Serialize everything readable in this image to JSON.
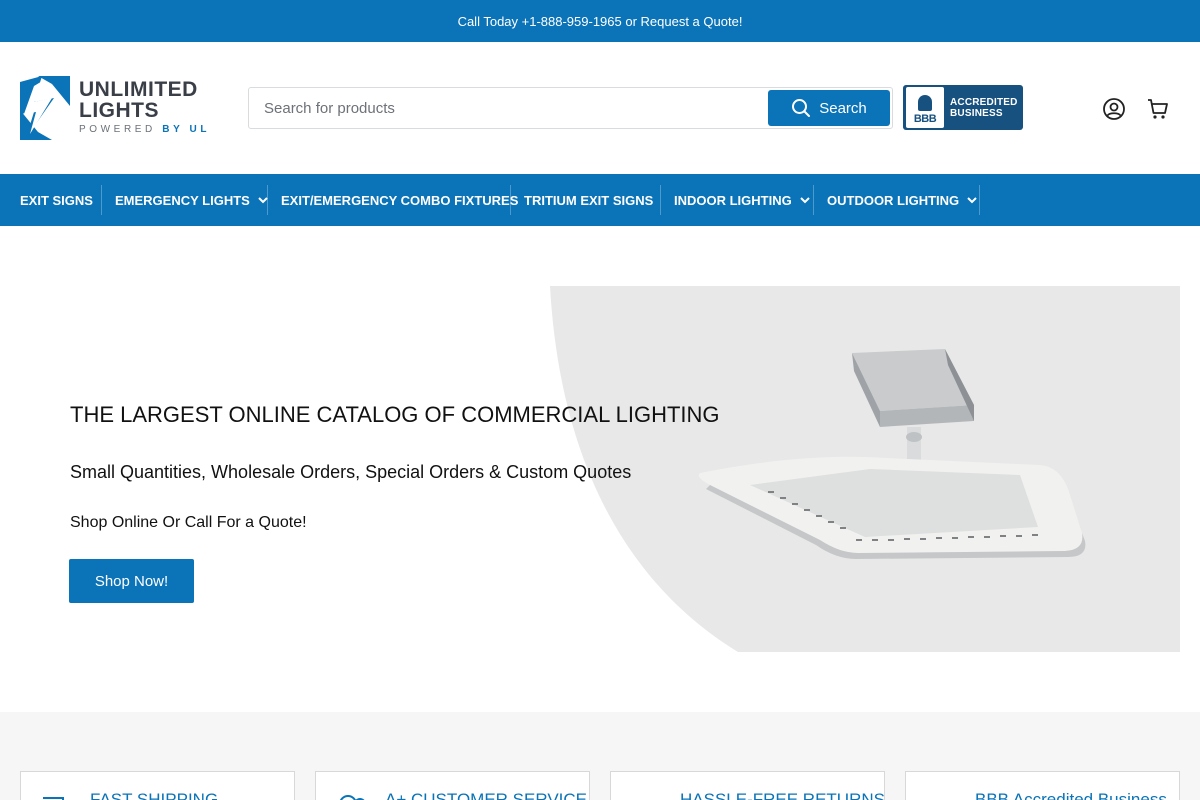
{
  "topbar": {
    "text": "Call Today +1-888-959-1965 or Request a Quote!"
  },
  "logo": {
    "line1": "UNLIMITED",
    "line2": "LIGHTS",
    "sub_prefix": "POWERED",
    "sub_brand": "BY UL"
  },
  "search": {
    "placeholder": "Search for products",
    "value": "",
    "button_label": "Search",
    "icon": "search-icon"
  },
  "bbb_badge": {
    "mark": "BBB",
    "line1": "ACCREDITED",
    "line2": "BUSINESS"
  },
  "header_icons": [
    "account-icon",
    "cart-icon"
  ],
  "nav": {
    "items": [
      {
        "label": "EXIT SIGNS",
        "has_dropdown": false
      },
      {
        "label": "EMERGENCY LIGHTS",
        "has_dropdown": true
      },
      {
        "label": "EXIT/EMERGENCY COMBO FIXTURES",
        "has_dropdown": false
      },
      {
        "label": "TRITIUM EXIT SIGNS",
        "has_dropdown": false
      },
      {
        "label": "INDOOR LIGHTING",
        "has_dropdown": true
      },
      {
        "label": "OUTDOOR LIGHTING",
        "has_dropdown": true
      }
    ]
  },
  "hero": {
    "title": "THE LARGEST ONLINE CATALOG OF COMMERCIAL LIGHTING",
    "subtitle": "Small Quantities, Wholesale Orders, Special Orders & Custom Quotes",
    "cta_text": "Shop Online Or Call For a Quote!",
    "button_label": "Shop Now!"
  },
  "features": [
    {
      "label": "FAST SHIPPING",
      "icon": "truck-icon"
    },
    {
      "label": "A+ CUSTOMER SERVICE",
      "icon": "support-icon"
    },
    {
      "label": "HASSLE-FREE RETURNS",
      "icon": "return-icon"
    },
    {
      "label": "BBB Accredited Business",
      "icon": "badge-icon"
    }
  ],
  "colors": {
    "brand_blue": "#0b73b7",
    "bbb_blue": "#17517f",
    "hero_bg": "#e8e8e8"
  }
}
